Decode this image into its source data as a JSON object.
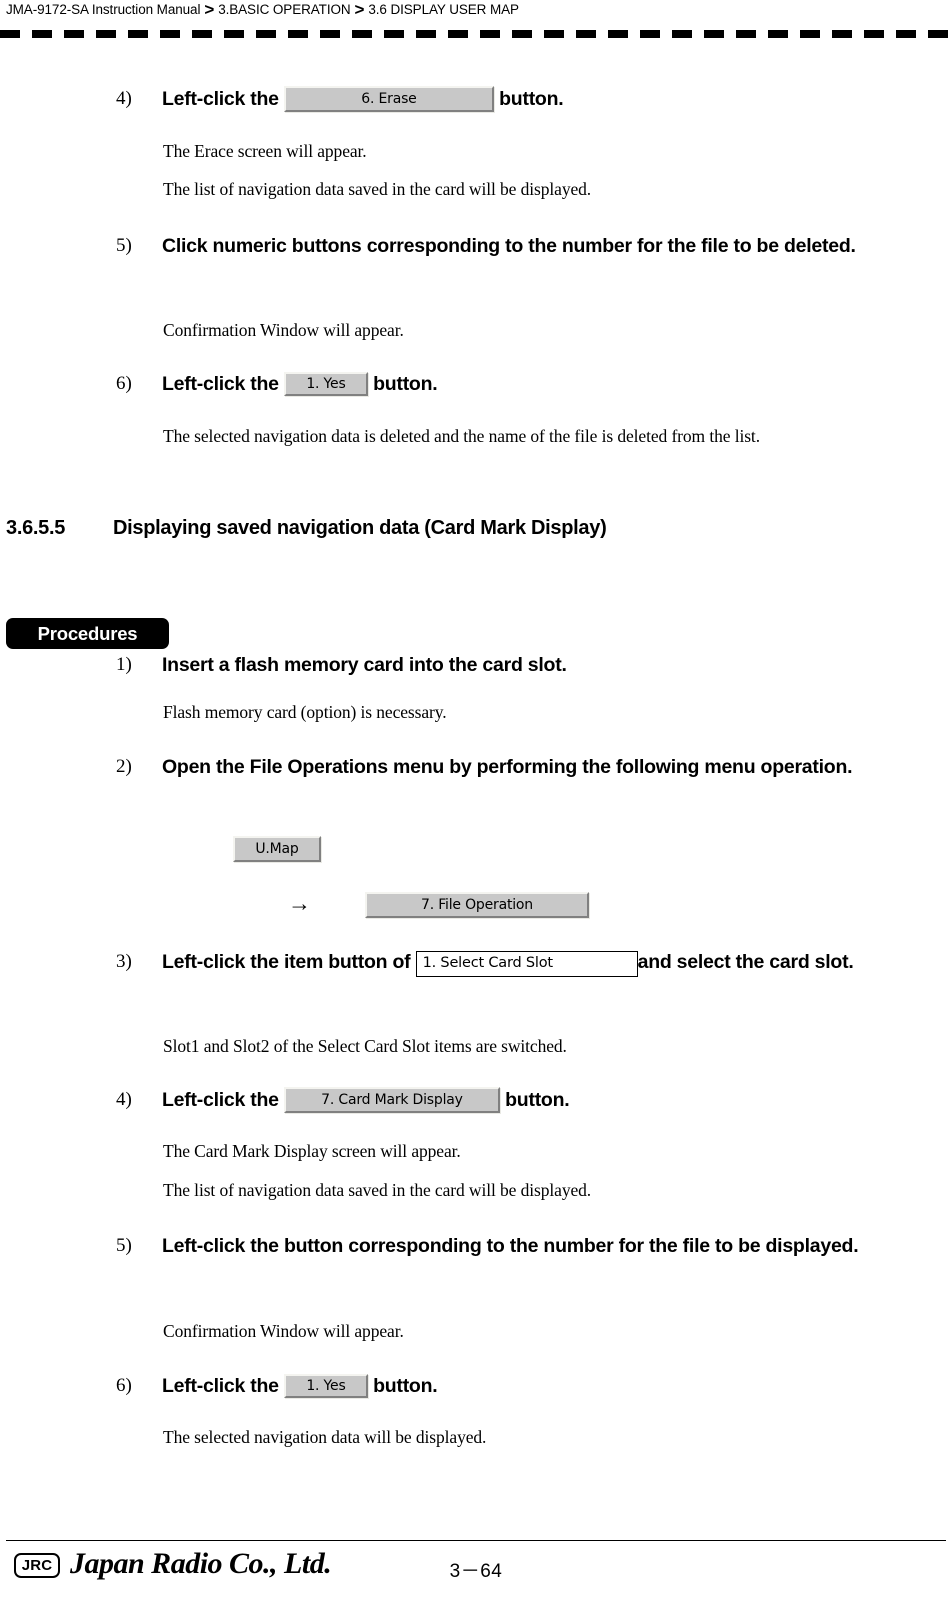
{
  "header": {
    "breadcrumb": [
      "JMA-9172-SA Instruction Manual",
      "3.BASIC OPERATION",
      "3.6  DISPLAY USER MAP"
    ],
    "separator": ">"
  },
  "section_top": {
    "steps": [
      {
        "num": "4)",
        "text_before": "Left-click the",
        "button": "6. Erase",
        "text_after": "button.",
        "notes": [
          "The Erace screen will appear.",
          "The list of navigation data saved in the card will be displayed."
        ]
      },
      {
        "num": "5)",
        "text": "Click numeric buttons corresponding to the number for the file to be deleted.",
        "notes": [
          "Confirmation Window will appear."
        ]
      },
      {
        "num": "6)",
        "text_before": "Left-click the",
        "button": "1. Yes",
        "text_after": "button.",
        "notes": [
          "The selected navigation data is deleted and the name of the file is deleted from the list."
        ]
      }
    ]
  },
  "section": {
    "number": "3.6.5.5",
    "title": "Displaying saved navigation data (Card Mark Display)",
    "procedures_label": "Procedures"
  },
  "procedures": {
    "steps": [
      {
        "num": "1)",
        "text": "Insert a flash memory card into the card slot.",
        "notes": [
          "Flash memory card (option) is necessary."
        ]
      },
      {
        "num": "2)",
        "text": "Open the File Operations menu by performing the following menu operation.",
        "menu_button_1": "U.Map",
        "menu_arrow": "→",
        "menu_button_2": "7. File Operation"
      },
      {
        "num": "3)",
        "text_before": "Left-click the item button of",
        "field": "1. Select Card Slot",
        "text_after": "and select the card slot.",
        "notes": [
          "Slot1 and Slot2 of the Select Card Slot items are switched."
        ]
      },
      {
        "num": "4)",
        "text_before": "Left-click the",
        "button": "7. Card Mark Display",
        "text_after": "button.",
        "notes": [
          "The Card Mark Display screen will appear.",
          "The list of navigation data saved in the card will be displayed."
        ]
      },
      {
        "num": "5)",
        "text": "Left-click the button corresponding to the number for the file to be displayed.",
        "notes": [
          "Confirmation Window will appear."
        ]
      },
      {
        "num": "6)",
        "text_before": "Left-click the",
        "button": "1. Yes",
        "text_after": "button.",
        "notes": [
          "The selected navigation data will be displayed."
        ]
      }
    ]
  },
  "footer": {
    "logo_badge": "JRC",
    "company": "Japan Radio Co., Ltd.",
    "page": "3－64"
  }
}
